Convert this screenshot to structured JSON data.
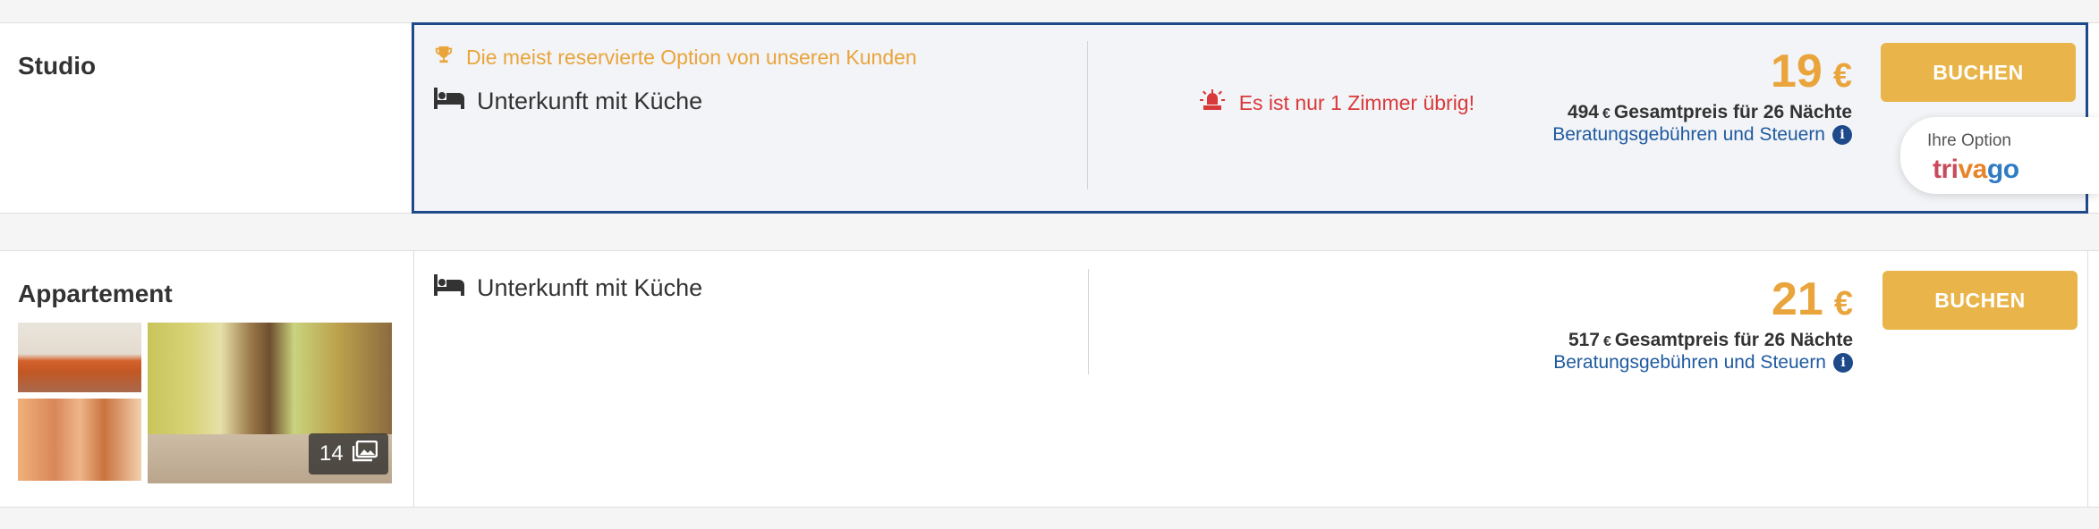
{
  "rooms": [
    {
      "name": "Studio",
      "badge": "Die meist reservierte Option von unseren Kunden",
      "feature": "Unterkunft mit Küche",
      "urgency": "Es ist nur 1 Zimmer übrig!",
      "price": "19",
      "currency": "€",
      "total_amount": "494",
      "total_currency": "€",
      "total_label": "Gesamtpreis für 26 Nächte",
      "fees_label": "Beratungsgebühren und Steuern",
      "book_label": "BUCHEN",
      "choice_label": "Ihre Option",
      "brand": "trivago",
      "highlight_color": "#1f4a8a"
    },
    {
      "name": "Appartement",
      "feature": "Unterkunft mit Küche",
      "price": "21",
      "currency": "€",
      "total_amount": "517",
      "total_currency": "€",
      "total_label": "Gesamtpreis für 26 Nächte",
      "fees_label": "Beratungsgebühren und Steuern",
      "book_label": "BUCHEN",
      "photo_count": "14"
    }
  ],
  "colors": {
    "accent": "#e9a43b",
    "button": "#e9b54a",
    "link": "#1f5aa0",
    "urgent": "#d8393a"
  }
}
